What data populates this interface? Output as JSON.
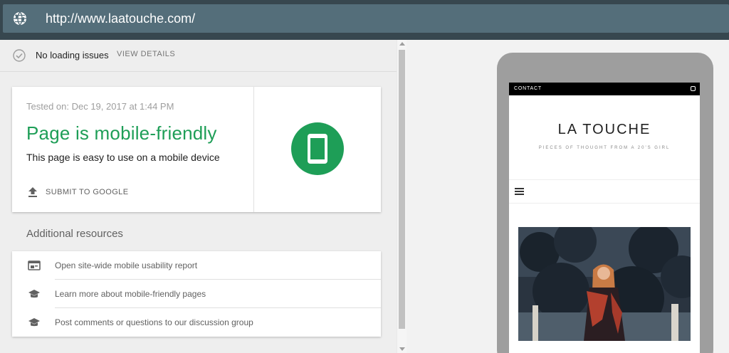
{
  "url_bar": {
    "url": "http://www.laatouche.com/",
    "icon": "globe-icon"
  },
  "status": {
    "text": "No loading issues",
    "view_details": "VIEW DETAILS",
    "icon": "check-circle-icon"
  },
  "result": {
    "tested_on": "Tested on: Dec 19, 2017 at 1:44 PM",
    "headline": "Page is mobile-friendly",
    "subline": "This page is easy to use on a mobile device",
    "submit_label": "SUBMIT TO GOOGLE",
    "accent_color": "#1e9e57"
  },
  "resources": {
    "heading": "Additional resources",
    "items": [
      {
        "label": "Open site-wide mobile usability report",
        "icon": "report-icon"
      },
      {
        "label": "Learn more about mobile-friendly pages",
        "icon": "school-icon"
      },
      {
        "label": "Post comments or questions to our discussion group",
        "icon": "school-icon"
      }
    ]
  },
  "preview": {
    "contact": "CONTACT",
    "site_title": "LA TOUCHE",
    "tagline": "PIECES OF THOUGHT FROM A 20'S GIRL"
  }
}
